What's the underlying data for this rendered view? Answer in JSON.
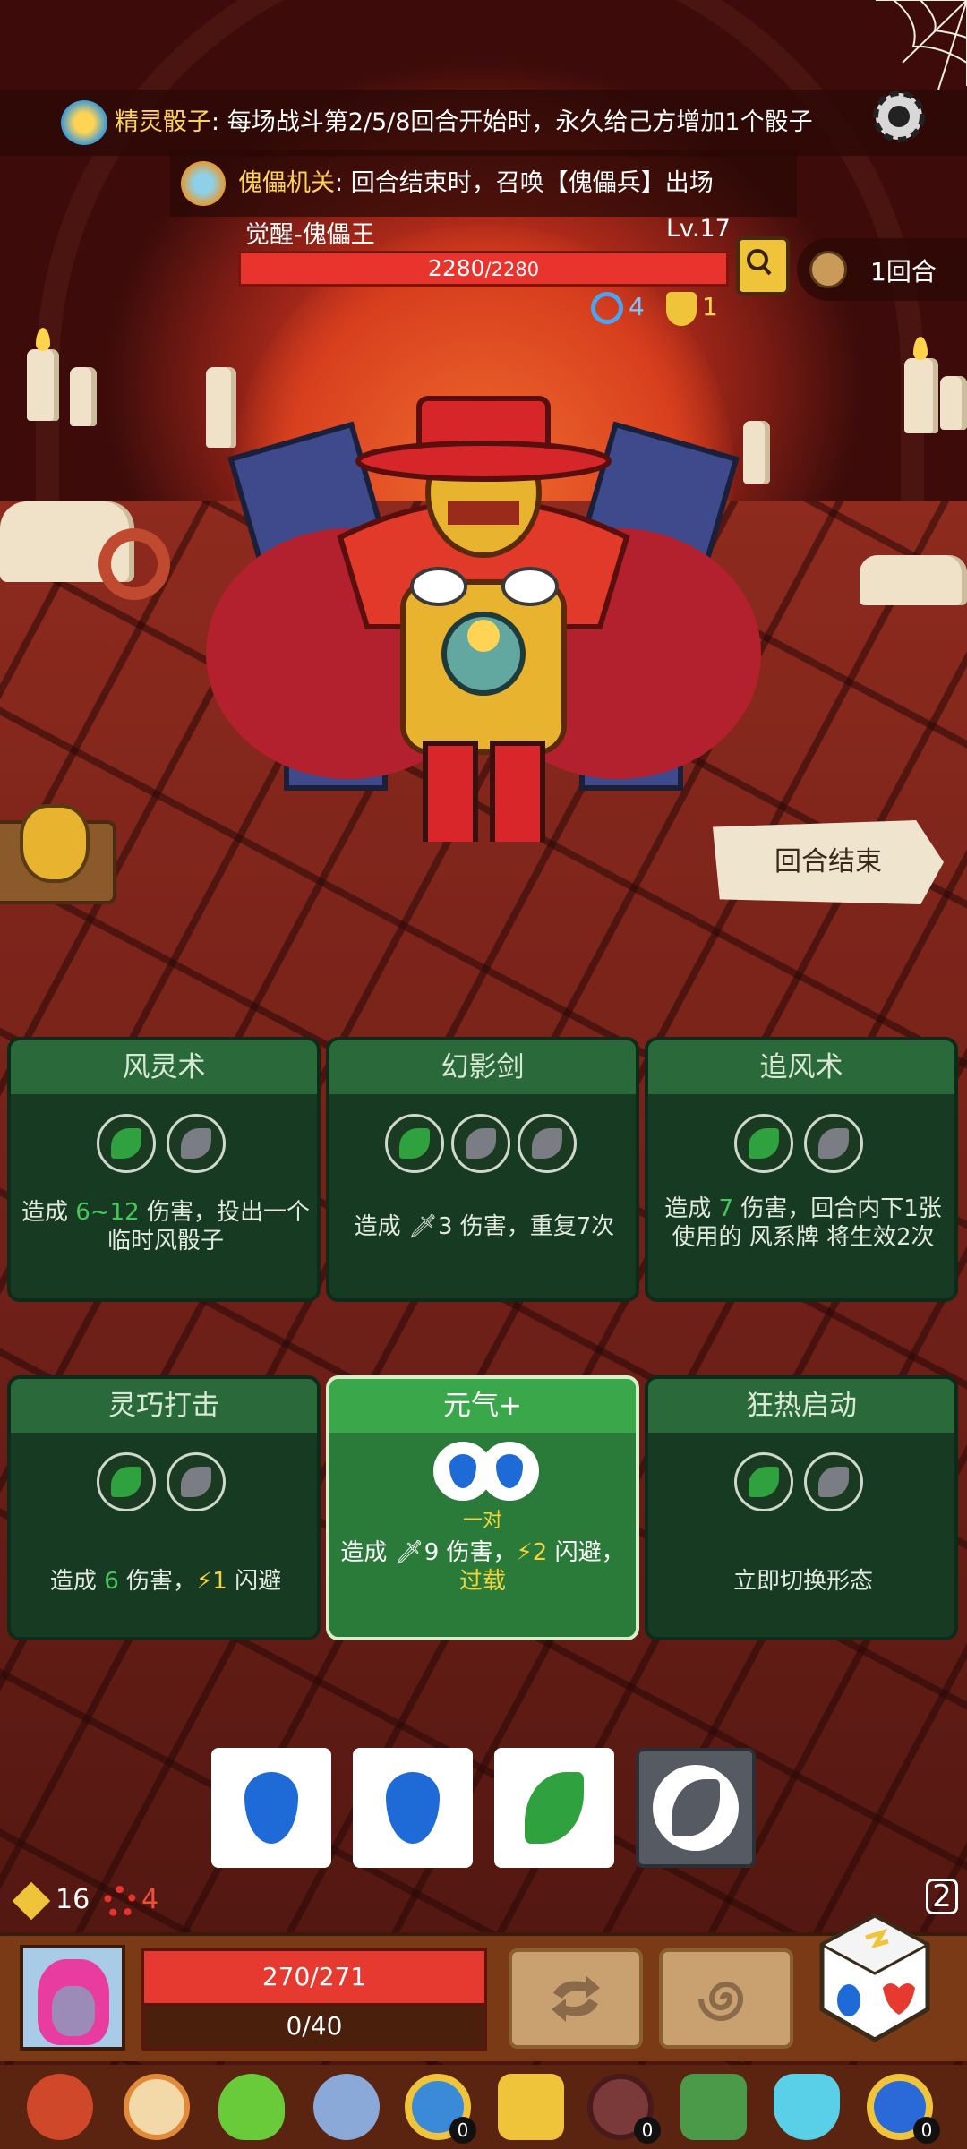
{
  "top": {
    "effect1": {
      "name": "精灵骰子",
      "sep": ":",
      "text": " 每场战斗第2/5/8回合开始时，永久给己方增加1个骰子"
    },
    "effect2": {
      "name": "傀儡机关",
      "sep": ":",
      "text": " 回合结束时，召唤【傀儡兵】出场"
    }
  },
  "boss": {
    "name": "觉醒-傀儡王",
    "level": "Lv.17",
    "hp_current": "2280",
    "hp_max": "/2280",
    "buff_spiral": "4",
    "buff_shield": "1"
  },
  "round": {
    "label": "1回合"
  },
  "end_turn": {
    "label": "回合结束"
  },
  "cards": [
    {
      "title": "风灵术",
      "desc_pre": "造成 ",
      "desc_val": "6~12",
      "desc_post": " 伤害，投出一个临时风骰子"
    },
    {
      "title": "幻影剑",
      "desc_pre": "造成 ",
      "desc_val": "3",
      "desc_post": " 伤害，重复7次"
    },
    {
      "title": "追风术",
      "desc_pre": "造成 ",
      "desc_val": "7",
      "desc_post": " 伤害，回合内下1张使用的 ",
      "desc_tail": "风系牌 将生效2次"
    },
    {
      "title": "灵巧打击",
      "desc_pre": "造成 ",
      "desc_val": "6",
      "desc_post": " 伤害，",
      "desc_val2": "1",
      "desc_tail": " 闪避"
    },
    {
      "title": "元气+",
      "pair": "一对",
      "desc_pre": "造成 ",
      "desc_val": "9",
      "desc_post": " 伤害，",
      "desc_val2": "2",
      "desc_tail": " 闪避，",
      "desc_extra": "过载"
    },
    {
      "title": "狂热启动",
      "desc_pre": "立即切换形态"
    }
  ],
  "dice_tray": [
    "water",
    "water",
    "wind-green",
    "wind-gray"
  ],
  "player": {
    "gold": "16",
    "rage": "4",
    "hp": "270/271",
    "shield": "0/40",
    "dice_count": "2"
  },
  "relics": [
    {
      "icon": "horn-mask-icon",
      "badge": ""
    },
    {
      "icon": "gear-ring-icon",
      "badge": ""
    },
    {
      "icon": "potion-icon",
      "badge": ""
    },
    {
      "icon": "tusk-icon",
      "badge": ""
    },
    {
      "icon": "ring-icon",
      "badge": "0"
    },
    {
      "icon": "crystal-hand-icon",
      "badge": ""
    },
    {
      "icon": "button-icon",
      "badge": "0"
    },
    {
      "icon": "green-leaf-icon",
      "badge": ""
    },
    {
      "icon": "blue-gem-icon",
      "badge": ""
    },
    {
      "icon": "sapphire-ring-icon",
      "badge": "0"
    }
  ],
  "colors": {
    "hp": "#e8342c",
    "card_bg": "#1f4a2c",
    "card_active": "#2f8a3f",
    "gold": "#ffd454"
  }
}
